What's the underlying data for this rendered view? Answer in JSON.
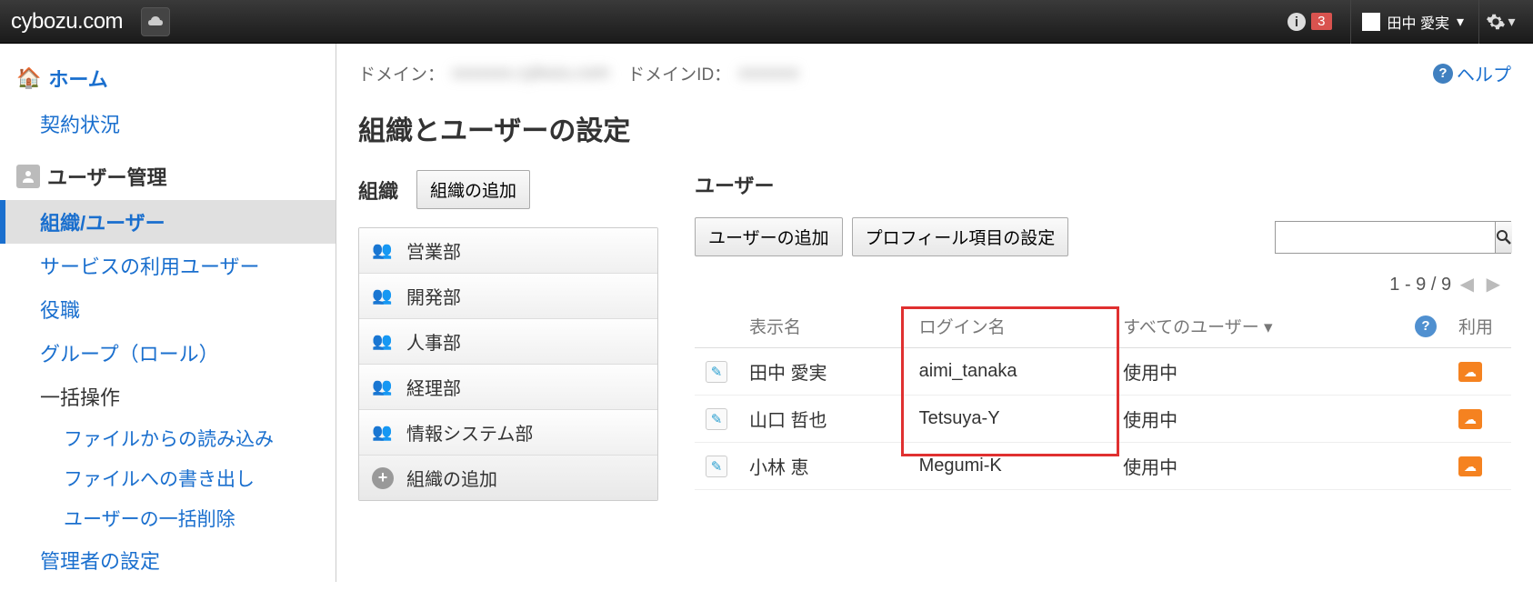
{
  "topbar": {
    "logo": "cybozu.com",
    "notif_count": "3",
    "user_name": "田中 愛実"
  },
  "sidebar": {
    "home": "ホーム",
    "contract": "契約状況",
    "user_mgmt": "ユーザー管理",
    "org_users": "組織/ユーザー",
    "service_users": "サービスの利用ユーザー",
    "roles": "役職",
    "groups": "グループ（ロール）",
    "bulk": "一括操作",
    "import_file": "ファイルからの読み込み",
    "export_file": "ファイルへの書き出し",
    "bulk_delete": "ユーザーの一括削除",
    "admin_settings": "管理者の設定"
  },
  "main": {
    "domain_label": "ドメイン：",
    "domain_value": "xxxxxxx.cybozu.com",
    "domain_id_label": "ドメインID：",
    "domain_id_value": "xxxxxxx",
    "help": "ヘルプ",
    "title": "組織とユーザーの設定"
  },
  "org": {
    "heading": "組織",
    "add_btn": "組織の追加",
    "items": [
      "営業部",
      "開発部",
      "人事部",
      "経理部",
      "情報システム部"
    ],
    "add_row": "組織の追加"
  },
  "users": {
    "heading": "ユーザー",
    "add_btn": "ユーザーの追加",
    "profile_btn": "プロフィール項目の設定",
    "pager": "1 - 9 / 9",
    "th_display": "表示名",
    "th_login": "ログイン名",
    "th_all": "すべてのユーザー",
    "th_use": "利用",
    "rows": [
      {
        "display": "田中 愛実",
        "login": "aimi_tanaka",
        "status": "使用中"
      },
      {
        "display": "山口 哲也",
        "login": "Tetsuya-Y",
        "status": "使用中"
      },
      {
        "display": "小林 恵",
        "login": "Megumi-K",
        "status": "使用中"
      }
    ]
  }
}
